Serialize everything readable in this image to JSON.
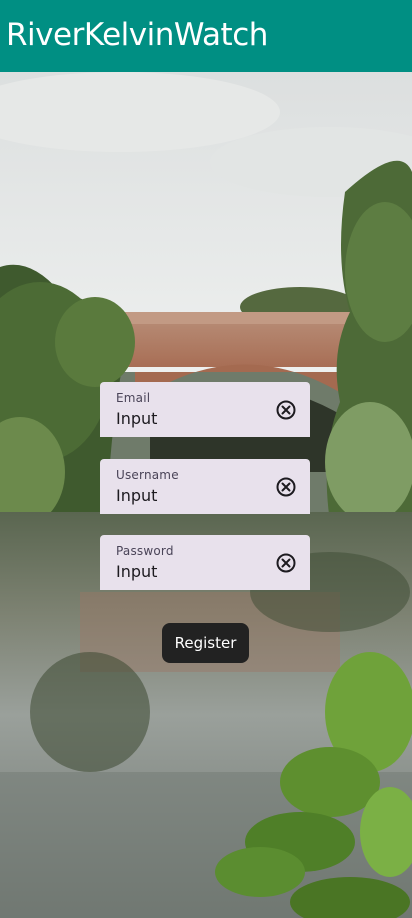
{
  "app_bar": {
    "title": "RiverKelvinWatch",
    "color": "#008f83"
  },
  "background": {
    "description_icon": "river-bridge-photo"
  },
  "form": {
    "fields": [
      {
        "label": "Email",
        "value": "Input",
        "icon": "clear-circle-icon"
      },
      {
        "label": "Username",
        "value": "Input",
        "icon": "clear-circle-icon"
      },
      {
        "label": "Password",
        "value": "Input",
        "icon": "clear-circle-icon"
      }
    ],
    "register_label": "Register"
  },
  "colors": {
    "field_background": "#e8e1ec",
    "button_background": "#222222"
  }
}
